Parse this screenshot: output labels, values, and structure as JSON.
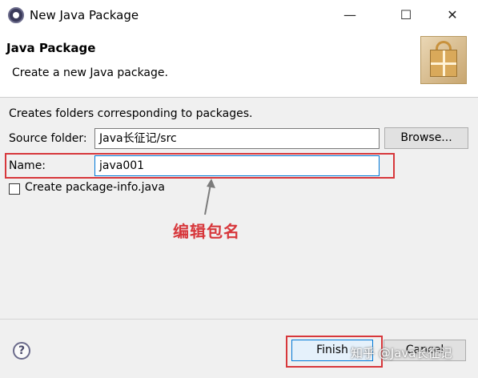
{
  "window": {
    "title": "New Java Package",
    "minimize_glyph": "—",
    "maximize_glyph": "☐",
    "close_glyph": "✕"
  },
  "header": {
    "title": "Java Package",
    "description": "Create a new Java package."
  },
  "form": {
    "description": "Creates folders corresponding to packages.",
    "source_folder_label": "Source folder:",
    "source_folder_value": "Java长征记/src",
    "browse_label": "Browse...",
    "name_label": "Name:",
    "name_value": "java001",
    "create_package_info_label": "Create package-info.java",
    "create_package_info_checked": false
  },
  "annotation": {
    "text": "编辑包名",
    "color": "#d7373b"
  },
  "footer": {
    "help_glyph": "?",
    "finish_label": "Finish",
    "cancel_label": "Cancel"
  },
  "watermark": {
    "text": "知乎 @Java长征记"
  },
  "icons": [
    "eclipse-app-icon",
    "package-banner-icon",
    "help-icon"
  ]
}
